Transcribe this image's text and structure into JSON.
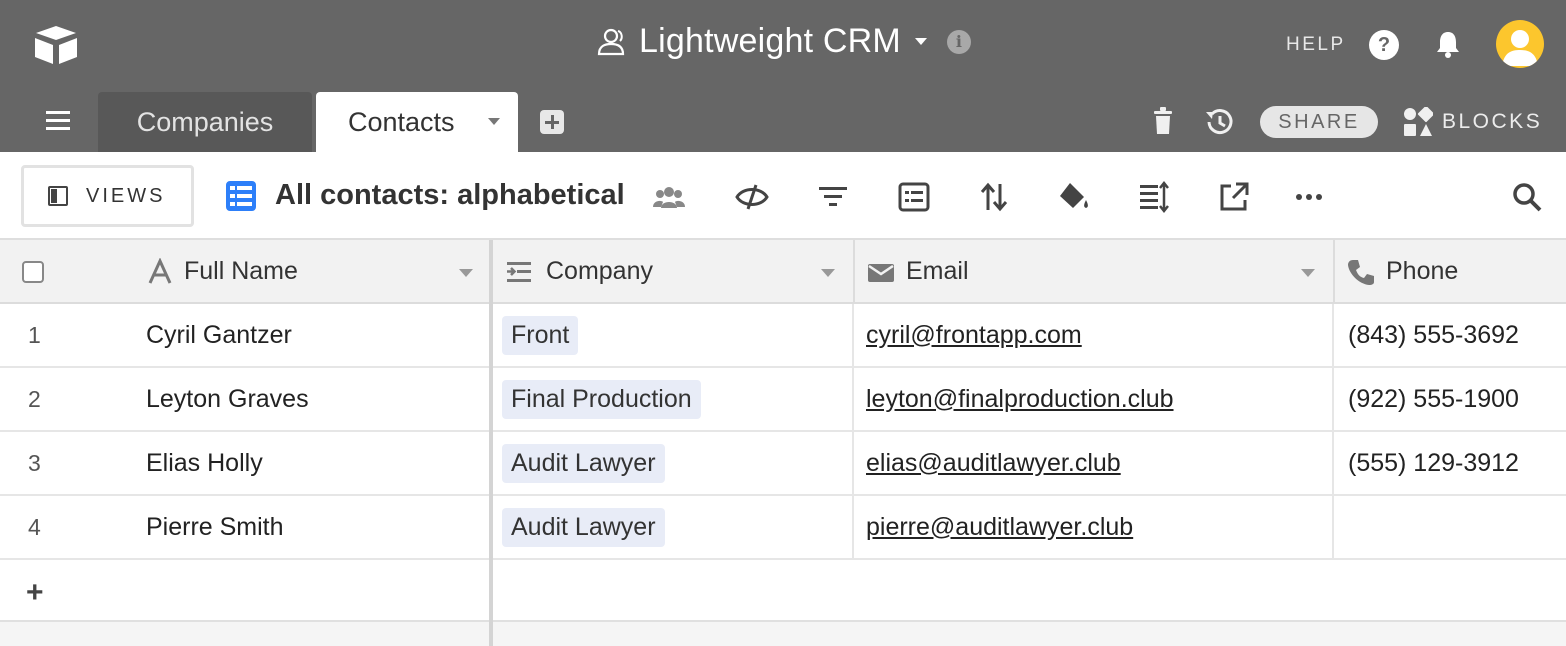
{
  "app": {
    "base_title": "Lightweight CRM",
    "help_label": "HELP",
    "share_label": "SHARE",
    "blocks_label": "BLOCKS"
  },
  "tabs": [
    {
      "label": "Companies",
      "active": false
    },
    {
      "label": "Contacts",
      "active": true
    }
  ],
  "viewbar": {
    "views_label": "VIEWS",
    "view_name": "All contacts: alphabetical",
    "tool_icons": [
      "collaborators-icon",
      "hide-fields-icon",
      "filter-icon",
      "group-icon",
      "sort-icon",
      "color-icon",
      "row-height-icon",
      "share-view-icon",
      "more-icon"
    ]
  },
  "table": {
    "columns": [
      {
        "label": "Full Name",
        "icon": "text-field-icon"
      },
      {
        "label": "Company",
        "icon": "link-field-icon"
      },
      {
        "label": "Email",
        "icon": "email-field-icon"
      },
      {
        "label": "Phone",
        "icon": "phone-field-icon"
      }
    ],
    "rows": [
      {
        "num": "1",
        "name": "Cyril Gantzer",
        "company": "Front",
        "email": "cyril@frontapp.com",
        "phone": "(843) 555-3692"
      },
      {
        "num": "2",
        "name": "Leyton Graves",
        "company": "Final Production",
        "email": "leyton@finalproduction.club",
        "phone": "(922) 555-1900"
      },
      {
        "num": "3",
        "name": "Elias Holly",
        "company": "Audit Lawyer",
        "email": "elias@auditlawyer.club",
        "phone": "(555) 129-3912"
      },
      {
        "num": "4",
        "name": "Pierre Smith",
        "company": "Audit Lawyer",
        "email": "pierre@auditlawyer.club",
        "phone": ""
      }
    ],
    "add_row_label": "+"
  },
  "colors": {
    "topbar": "#666666",
    "accent_blue": "#2d7ff9",
    "avatar": "#fcc62d",
    "pill": "#e8ecf7"
  }
}
